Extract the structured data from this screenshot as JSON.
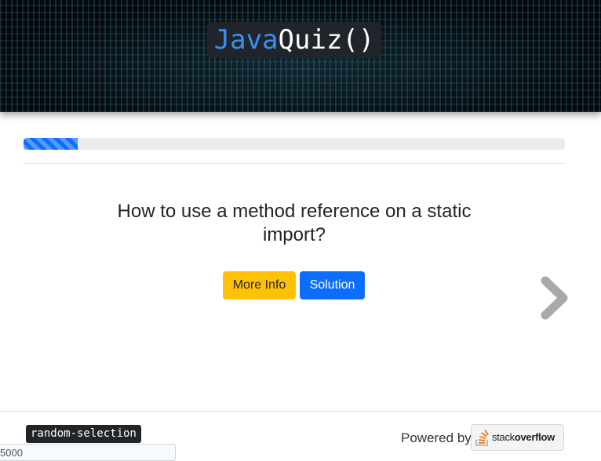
{
  "header": {
    "logo_part1": "Java",
    "logo_part2": "Quiz()",
    "colors": {
      "java": "#3d8df5",
      "background": "#04090d"
    }
  },
  "progress": {
    "fraction": 0.1
  },
  "question": {
    "text": "How to use a method reference on a static import?"
  },
  "buttons": {
    "more_info": "More Info",
    "solution": "Solution",
    "colors": {
      "more_info": "#ffc107",
      "solution": "#0d6efd"
    }
  },
  "navigation": {
    "next_icon": "chevron-right-icon"
  },
  "footer": {
    "mode_tag": "random-selection",
    "seed_value": "5000",
    "powered_by": "Powered by",
    "logo": {
      "part1": "stack",
      "part2": "overflow"
    }
  }
}
